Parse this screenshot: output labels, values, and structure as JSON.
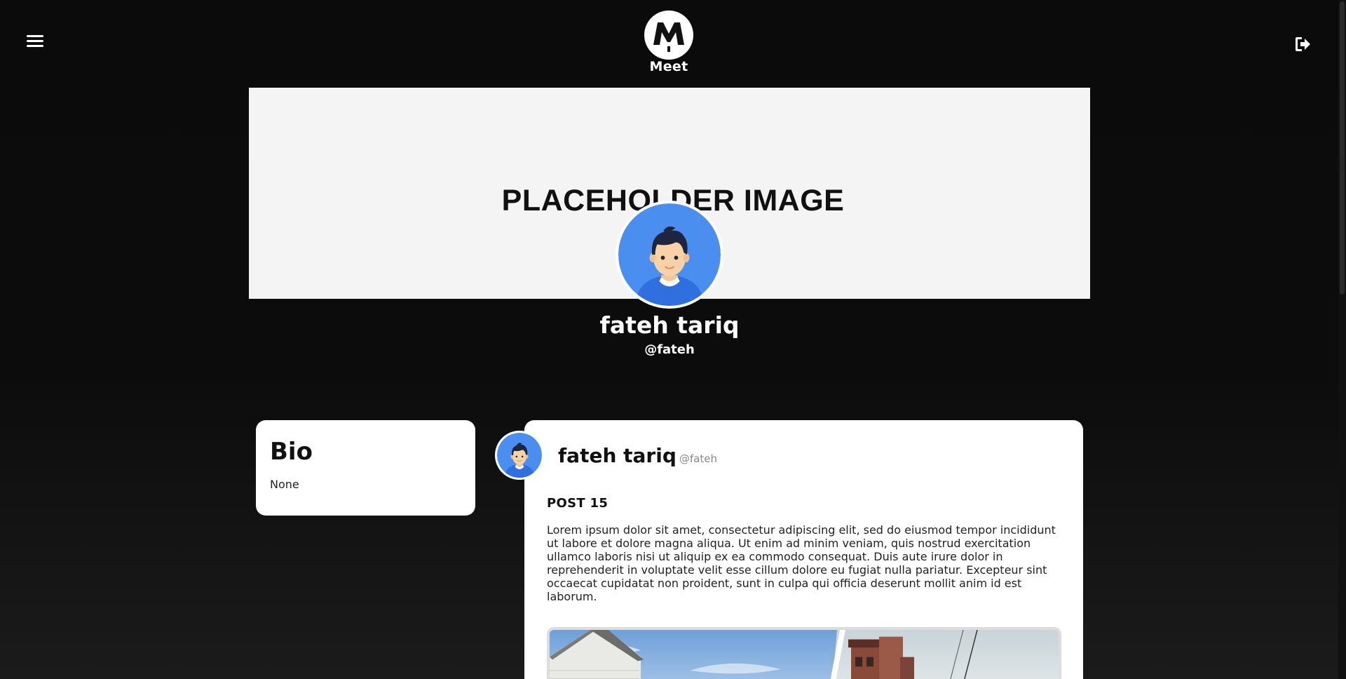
{
  "header": {
    "brand_name": "Meet",
    "logo_letter": "M"
  },
  "cover": {
    "placeholder_text": "PLACEHOLDER IMAGE"
  },
  "profile": {
    "name": "fateh tariq",
    "handle": "@fateh"
  },
  "bio": {
    "title": "Bio",
    "text": "None"
  },
  "post": {
    "author": "fateh tariq",
    "handle": "@fateh",
    "title": "POST 15",
    "body": "Lorem ipsum dolor sit amet, consectetur adipiscing elit, sed do eiusmod tempor incididunt ut labore et dolore magna aliqua. Ut enim ad minim veniam, quis nostrud exercitation ullamco laboris nisi ut aliquip ex ea commodo consequat. Duis aute irure dolor in reprehenderit in voluptate velit esse cillum dolore eu fugiat nulla pariatur. Excepteur sint occaecat cupidatat non proident, sunt in culpa qui officia deserunt mollit anim id est laborum."
  },
  "icons": {
    "menu": "hamburger-menu-icon",
    "logout": "logout-icon",
    "avatar": "user-avatar-icon"
  },
  "colors": {
    "background": "#0b0b0b",
    "card": "#ffffff",
    "avatar_blue": "#4a8ff0",
    "text_dark": "#111111"
  }
}
